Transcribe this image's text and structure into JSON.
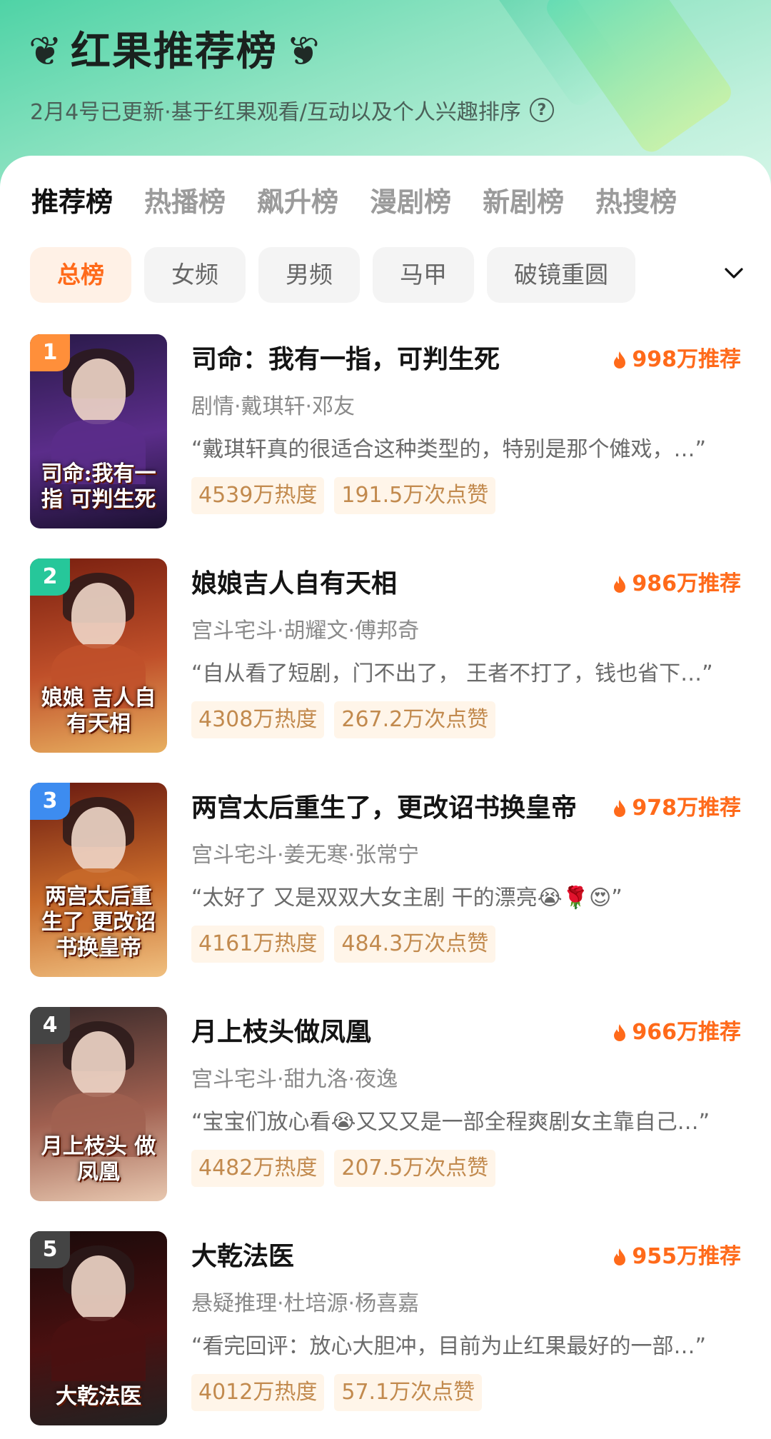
{
  "header": {
    "title": "红果推荐榜",
    "subtitle": "2月4号已更新·基于红果观看/互动以及个人兴趣排序",
    "help_icon_label": "?"
  },
  "tabs": [
    {
      "label": "推荐榜",
      "active": true
    },
    {
      "label": "热播榜",
      "active": false
    },
    {
      "label": "飙升榜",
      "active": false
    },
    {
      "label": "漫剧榜",
      "active": false
    },
    {
      "label": "新剧榜",
      "active": false
    },
    {
      "label": "热搜榜",
      "active": false
    }
  ],
  "filters": [
    {
      "label": "总榜",
      "active": true
    },
    {
      "label": "女频",
      "active": false
    },
    {
      "label": "男频",
      "active": false
    },
    {
      "label": "马甲",
      "active": false
    },
    {
      "label": "破镜重圆",
      "active": false
    }
  ],
  "colors": {
    "accent": "#ff6a1a",
    "badge_text": "#c28a4e",
    "rank_1": "#ff8f3a",
    "rank_2": "#26c79a",
    "rank_3": "#3d8cf0",
    "rank_4": "#444444",
    "rank_5": "#444444"
  },
  "items": [
    {
      "rank": "1",
      "title": "司命：我有一指，可判生死",
      "recommend": "998万推荐",
      "meta": "剧情·戴琪轩·邓友",
      "quote": "“戴琪轩真的很适合这种类型的，特别是那个傩戏，…”",
      "heat": "4539万热度",
      "likes": "191.5万次点赞",
      "poster_text": "司命:我有一指 可判生死",
      "poster_colors": [
        "#2a1a4a",
        "#5b2d8a",
        "#1b1030"
      ]
    },
    {
      "rank": "2",
      "title": "娘娘吉人自有天相",
      "recommend": "986万推荐",
      "meta": "宫斗宅斗·胡耀文·傅邦奇",
      "quote": "“自从看了短剧，门不出了， 王者不打了，钱也省下…”",
      "heat": "4308万热度",
      "likes": "267.2万次点赞",
      "poster_text": "娘娘 吉人自有天相",
      "poster_colors": [
        "#7a2010",
        "#c0502a",
        "#e8b060"
      ]
    },
    {
      "rank": "3",
      "title": "两宫太后重生了，更改诏书换皇帝",
      "recommend": "978万推荐",
      "meta": "宫斗宅斗·姜无寒·张常宁",
      "quote": "“太好了 又是双双大女主剧 干的漂亮😭🌹😍”",
      "heat": "4161万热度",
      "likes": "484.3万次点赞",
      "poster_text": "两宫太后重生了 更改诏书换皇帝",
      "poster_colors": [
        "#6a1a10",
        "#c86a2a",
        "#f0c080"
      ]
    },
    {
      "rank": "4",
      "title": "月上枝头做凤凰",
      "recommend": "966万推荐",
      "meta": "宫斗宅斗·甜九洛·夜逸",
      "quote": "“宝宝们放心看😭又又又是一部全程爽剧女主靠自己…”",
      "heat": "4482万热度",
      "likes": "207.5万次点赞",
      "poster_text": "月上枝头 做凤凰",
      "poster_colors": [
        "#3a2a2a",
        "#a06050",
        "#e8c8b0"
      ]
    },
    {
      "rank": "5",
      "title": "大乾法医",
      "recommend": "955万推荐",
      "meta": "悬疑推理·杜培源·杨喜嘉",
      "quote": "“看完回评：放心大胆冲，目前为止红果最好的一部…”",
      "heat": "4012万热度",
      "likes": "57.1万次点赞",
      "poster_text": "大乾法医",
      "poster_colors": [
        "#1a0a0a",
        "#4a1010",
        "#222222"
      ]
    }
  ]
}
